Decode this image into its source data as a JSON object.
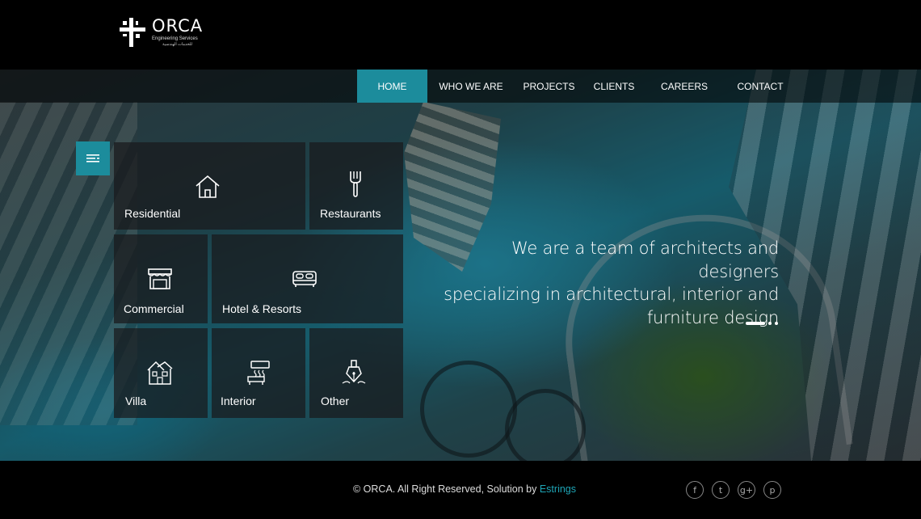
{
  "brand": {
    "name": "ORCA",
    "tagline_small": "Engineering Services",
    "arabic": "للخدمات الهندسية"
  },
  "nav": {
    "items": [
      {
        "label": "HOME",
        "active": true
      },
      {
        "label": "WHO WE ARE",
        "active": false
      },
      {
        "label": "PROJECTS",
        "active": false
      },
      {
        "label": "CLIENTS",
        "active": false
      },
      {
        "label": "CAREERS",
        "active": false
      },
      {
        "label": "CONTACT",
        "active": false
      }
    ]
  },
  "menu_toggle": {
    "icon": "menu-lines-icon"
  },
  "categories": [
    {
      "label": "Residential",
      "icon": "house-icon"
    },
    {
      "label": "Restaurants",
      "icon": "fork-icon"
    },
    {
      "label": "Commercial",
      "icon": "storefront-icon"
    },
    {
      "label": "Hotel & Resorts",
      "icon": "bed-icon"
    },
    {
      "label": "Villa",
      "icon": "villa-icon"
    },
    {
      "label": "Interior",
      "icon": "interior-icon"
    },
    {
      "label": "Other",
      "icon": "pen-nib-icon"
    }
  ],
  "hero": {
    "line1": "We are a team of architects and designers",
    "line2": "specializing in architectural, interior and",
    "line3": "furniture design",
    "slides_total": 3,
    "active_slide": 1
  },
  "footer": {
    "copyright": "© ORCA. All Right Reserved, Solution by ",
    "credit_link": "Estrings",
    "social": [
      {
        "name": "facebook",
        "glyph": "f",
        "icon": "facebook-icon"
      },
      {
        "name": "twitter",
        "glyph": "t",
        "icon": "twitter-icon"
      },
      {
        "name": "google-plus",
        "glyph": "g+",
        "icon": "google-plus-icon"
      },
      {
        "name": "pinterest",
        "glyph": "p",
        "icon": "pinterest-icon"
      }
    ]
  },
  "colors": {
    "accent": "#1c8c9c",
    "link": "#1ea5b6",
    "background": "#000000"
  }
}
